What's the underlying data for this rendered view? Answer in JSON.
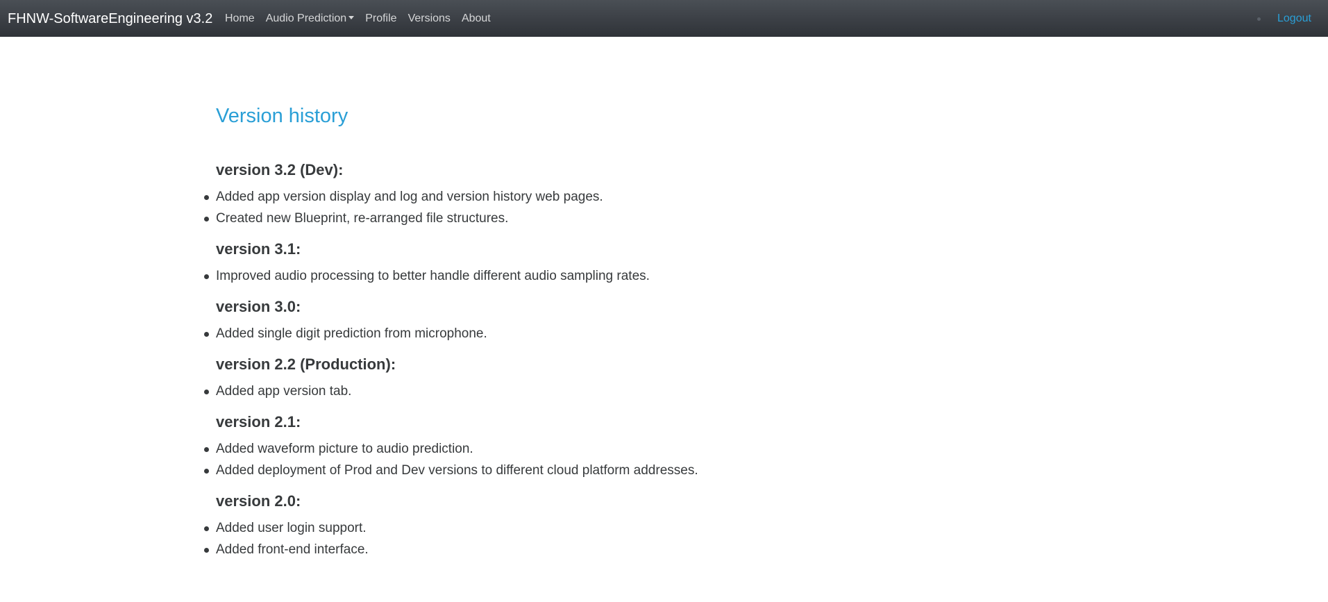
{
  "navbar": {
    "brand": "FHNW-SoftwareEngineering v3.2",
    "links": [
      {
        "label": "Home"
      },
      {
        "label": "Audio Prediction",
        "dropdown": true
      },
      {
        "label": "Profile"
      },
      {
        "label": "Versions"
      },
      {
        "label": "About"
      }
    ],
    "logout_label": "Logout"
  },
  "page": {
    "title": "Version history"
  },
  "versions": [
    {
      "heading": "version 3.2 (Dev):",
      "changes": [
        "Added app version display and log and version history web pages.",
        "Created new Blueprint, re-arranged file structures."
      ]
    },
    {
      "heading": "version 3.1:",
      "changes": [
        "Improved audio processing to better handle different audio sampling rates."
      ]
    },
    {
      "heading": "version 3.0:",
      "changes": [
        "Added single digit prediction from microphone."
      ]
    },
    {
      "heading": "version 2.2 (Production):",
      "changes": [
        "Added app version tab."
      ]
    },
    {
      "heading": "version 2.1:",
      "changes": [
        "Added waveform picture to audio prediction.",
        "Added deployment of Prod and Dev versions to different cloud platform addresses."
      ]
    },
    {
      "heading": "version 2.0:",
      "changes": [
        "Added user login support.",
        "Added front-end interface."
      ]
    }
  ],
  "colors": {
    "navbar_bg": "#3b3f45",
    "link_accent": "#2a9fd6",
    "text": "#373a3c"
  }
}
